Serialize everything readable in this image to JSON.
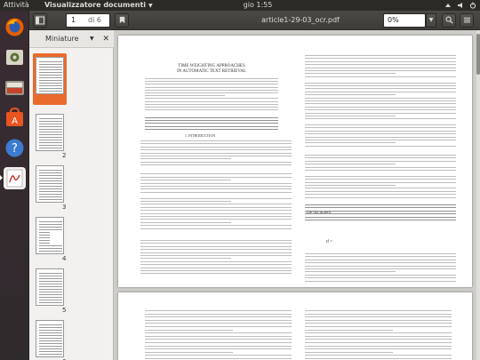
{
  "top_panel": {
    "activities": "Attività",
    "app_name": "Visualizzatore documenti",
    "clock": "gio  1:55"
  },
  "launcher": {
    "items": [
      "firefox-icon",
      "disk-icon",
      "files-icon",
      "software-center-icon",
      "help-icon",
      "pdf-viewer-icon"
    ]
  },
  "toolbar": {
    "page_current": "1",
    "page_of": "di 6",
    "document_title": "article1-29-03_ocr.pdf",
    "zoom": "0%"
  },
  "sidebar": {
    "title": "Miniature",
    "pages": [
      "",
      "2",
      "3",
      "4",
      "5",
      "6"
    ]
  },
  "document": {
    "page1_title": "TIME WEIGHTING APPROACHES\nIN AUTOMATIC TEXT RETRIEVAL",
    "section_heading": "1. INTRODUCTION",
    "the_document_label": "the document",
    "formula_label": "tf ="
  },
  "colors": {
    "accent": "#e96a2d",
    "panel": "#2b2a27"
  }
}
